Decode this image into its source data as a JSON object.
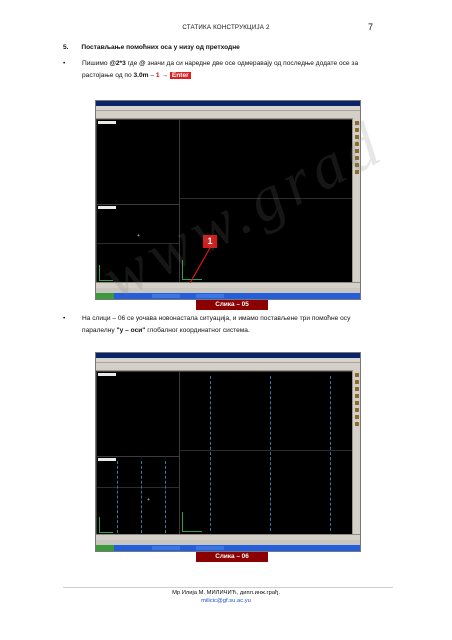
{
  "header": {
    "title": "СТАТИКА КОНСТРУКЦИЈА 2",
    "page_number": "7"
  },
  "section": {
    "number": "5.",
    "heading": "Постављање помоћних оса у низу од претходне"
  },
  "bullet1": {
    "marker": "•",
    "line1_pre": "Пишимо ",
    "line1_bold": "@2*3",
    "line1_mid": " где ",
    "line1_at": "@",
    "line1_post": " значи да си наредне две осе одмеравају од последње додате осе за",
    "line2_pre": "растојање од по ",
    "line2_bold": "3.0m",
    "line2_mid": " – ",
    "line2_red": "1",
    "line2_arrow": " → ",
    "line2_enter": "Enter"
  },
  "figure1": {
    "caption": "Слика – 05",
    "callout": "1"
  },
  "bullet2": {
    "marker": "•",
    "line1": "На слици – 06 се уочава новонастала ситуација, и имамо постављене три помоћне осу",
    "line2_pre": "паралелну ",
    "line2_bold": "\"y – оси\"",
    "line2_post": " глобалног координатног система."
  },
  "figure2": {
    "caption": "Слика – 06"
  },
  "watermark": "www.grad",
  "footer": {
    "author": "Мр Илија М. МИЛИЧИЋ, дипл.инж.грађ.",
    "email": "milicic@gf.su.ac.yu"
  }
}
